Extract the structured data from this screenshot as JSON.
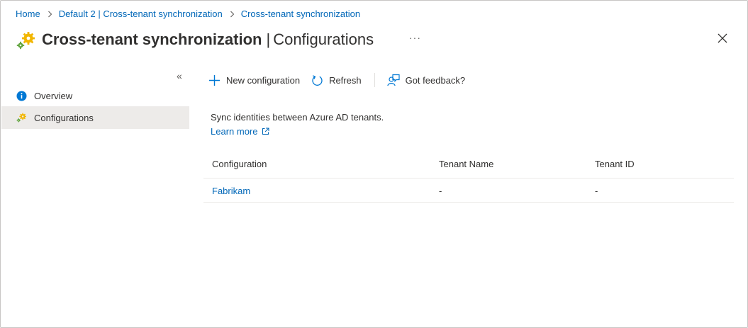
{
  "breadcrumb": {
    "items": [
      "Home",
      "Default 2 | Cross-tenant synchronization",
      "Cross-tenant synchronization"
    ]
  },
  "header": {
    "title": "Cross-tenant synchronization",
    "separator": "|",
    "subtitle": "Configurations",
    "more_label": "···",
    "icon": "gear-cluster-icon"
  },
  "sidebar": {
    "collapse_label": "«",
    "items": [
      {
        "label": "Overview",
        "icon": "info-icon",
        "active": false
      },
      {
        "label": "Configurations",
        "icon": "gear-cluster-icon",
        "active": true
      }
    ]
  },
  "toolbar": {
    "new_label": "New configuration",
    "refresh_label": "Refresh",
    "feedback_label": "Got feedback?"
  },
  "content": {
    "description": "Sync identities between Azure AD tenants.",
    "learn_more": "Learn more"
  },
  "table": {
    "columns": [
      "Configuration",
      "Tenant Name",
      "Tenant ID"
    ],
    "rows": [
      [
        "Fabrikam",
        "-",
        "-"
      ]
    ]
  },
  "colors": {
    "link": "#0067b8",
    "active_nav_bg": "#edebe9",
    "gear_yellow": "#f2b600",
    "gear_green": "#5ea33b",
    "info_blue": "#0078d4"
  }
}
